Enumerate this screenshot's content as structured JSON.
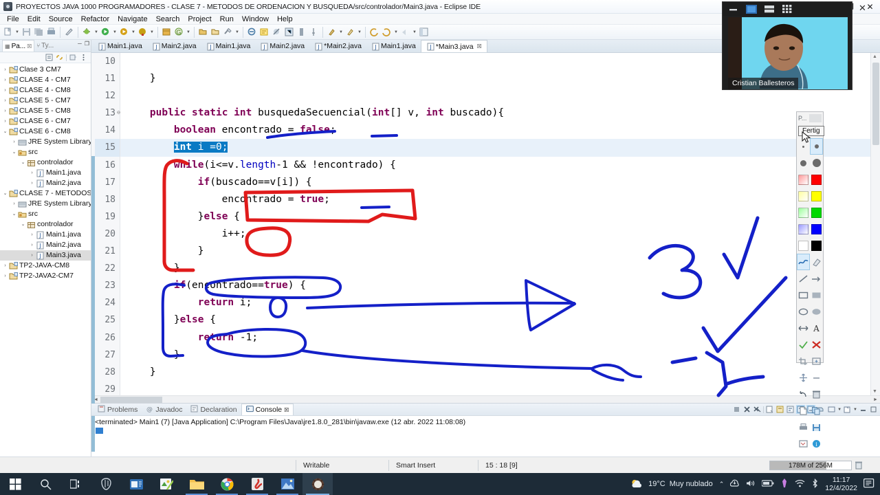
{
  "window": {
    "title": "PROYECTOS JAVA 1000 PROGRAMADORES - CLASE 7 - METODOS DE ORDENACION Y BUSQUEDA/src/controlador/Main3.java - Eclipse IDE",
    "icon": "eclipse-icon",
    "controls": {
      "minimize": "–",
      "maximize": "❐",
      "close": "✕"
    }
  },
  "menubar": {
    "items": [
      "File",
      "Edit",
      "Source",
      "Refactor",
      "Navigate",
      "Search",
      "Project",
      "Run",
      "Window",
      "Help"
    ]
  },
  "explorer": {
    "tabs": [
      {
        "label": "Pa...",
        "icon": "package-explorer-icon",
        "active": true,
        "close": "☒"
      },
      {
        "label": "Ty...",
        "icon": "type-hierarchy-icon",
        "active": false
      }
    ],
    "min_label": "─",
    "max_label": "❐",
    "toolbar_icons": [
      "collapse-all-icon",
      "link-with-editor-icon",
      "focus-icon",
      "view-menu-icon"
    ],
    "tree": [
      {
        "label": "Clase 3 CM7",
        "depth": 0,
        "icon": "java-project-icon",
        "twisty": "collapsed"
      },
      {
        "label": "CLASE 4 - CM7",
        "depth": 0,
        "icon": "java-project-icon",
        "twisty": "collapsed"
      },
      {
        "label": "CLASE 4 - CM8",
        "depth": 0,
        "icon": "java-project-icon",
        "twisty": "collapsed"
      },
      {
        "label": "CLASE 5 - CM7",
        "depth": 0,
        "icon": "java-project-icon",
        "twisty": "collapsed"
      },
      {
        "label": "CLASE 5 - CM8",
        "depth": 0,
        "icon": "java-project-icon",
        "twisty": "collapsed"
      },
      {
        "label": "CLASE 6 - CM7",
        "depth": 0,
        "icon": "java-project-icon",
        "twisty": "collapsed"
      },
      {
        "label": "CLASE 6 - CM8",
        "depth": 0,
        "icon": "java-project-icon",
        "twisty": "expanded"
      },
      {
        "label": "JRE System Library",
        "depth": 1,
        "icon": "jre-library-icon",
        "twisty": "collapsed"
      },
      {
        "label": "src",
        "depth": 1,
        "icon": "source-folder-icon",
        "twisty": "expanded"
      },
      {
        "label": "controlador",
        "depth": 2,
        "icon": "package-icon",
        "twisty": "expanded"
      },
      {
        "label": "Main1.java",
        "depth": 3,
        "icon": "java-file-icon",
        "twisty": "collapsed"
      },
      {
        "label": "Main2.java",
        "depth": 3,
        "icon": "java-file-icon",
        "twisty": "collapsed"
      },
      {
        "label": "CLASE 7 - METODOS",
        "depth": 0,
        "icon": "java-project-icon",
        "twisty": "expanded"
      },
      {
        "label": "JRE System Library",
        "depth": 1,
        "icon": "jre-library-icon",
        "twisty": "collapsed"
      },
      {
        "label": "src",
        "depth": 1,
        "icon": "source-folder-icon",
        "twisty": "expanded"
      },
      {
        "label": "controlador",
        "depth": 2,
        "icon": "package-icon",
        "twisty": "expanded"
      },
      {
        "label": "Main1.java",
        "depth": 3,
        "icon": "java-file-icon",
        "twisty": "collapsed"
      },
      {
        "label": "Main2.java",
        "depth": 3,
        "icon": "java-file-icon",
        "twisty": "collapsed"
      },
      {
        "label": "Main3.java",
        "depth": 3,
        "icon": "java-file-icon",
        "twisty": "collapsed",
        "selected": true
      },
      {
        "label": "TP2-JAVA-CM8",
        "depth": 0,
        "icon": "java-project-icon",
        "twisty": "collapsed"
      },
      {
        "label": "TP2-JAVA2-CM7",
        "depth": 0,
        "icon": "java-project-icon",
        "twisty": "collapsed"
      }
    ]
  },
  "editor": {
    "tabs": [
      {
        "label": "Main1.java",
        "active": false,
        "dirty": false
      },
      {
        "label": "Main2.java",
        "active": false,
        "dirty": false
      },
      {
        "label": "Main1.java",
        "active": false,
        "dirty": false
      },
      {
        "label": "Main2.java",
        "active": false,
        "dirty": false
      },
      {
        "label": "*Main2.java",
        "active": false,
        "dirty": true
      },
      {
        "label": "Main1.java",
        "active": false,
        "dirty": false
      },
      {
        "label": "*Main3.java",
        "active": true,
        "dirty": true,
        "close": "☒"
      }
    ],
    "first_line": 10,
    "highlighted_line": 15,
    "folding_line": 13,
    "lines": [
      {
        "n": 10,
        "text": ""
      },
      {
        "n": 11,
        "text": "    }"
      },
      {
        "n": 12,
        "text": ""
      },
      {
        "n": 13,
        "text": "    public static int busquedaSecuencial(int[] v, int buscado){"
      },
      {
        "n": 14,
        "text": "        boolean encontrado = false;"
      },
      {
        "n": 15,
        "text": "        int i =0;"
      },
      {
        "n": 16,
        "text": "        while(i<=v.length-1 && !encontrado) {"
      },
      {
        "n": 17,
        "text": "            if(buscado==v[i]) {"
      },
      {
        "n": 18,
        "text": "                encontrado = true;"
      },
      {
        "n": 19,
        "text": "            }else {"
      },
      {
        "n": 20,
        "text": "                i++;"
      },
      {
        "n": 21,
        "text": "            }"
      },
      {
        "n": 22,
        "text": "        }"
      },
      {
        "n": 23,
        "text": "        if(encontrado==true) {"
      },
      {
        "n": 24,
        "text": "            return i;"
      },
      {
        "n": 25,
        "text": "        }else {"
      },
      {
        "n": 26,
        "text": "            return -1;"
      },
      {
        "n": 27,
        "text": "        }"
      },
      {
        "n": 28,
        "text": "    }"
      },
      {
        "n": 29,
        "text": ""
      }
    ],
    "selection_text": "int i =0;"
  },
  "console": {
    "tabs": [
      {
        "label": "Problems",
        "icon": "problems-icon",
        "active": false
      },
      {
        "label": "Javadoc",
        "icon": "javadoc-icon",
        "active": false
      },
      {
        "label": "Declaration",
        "icon": "declaration-icon",
        "active": false
      },
      {
        "label": "Console",
        "icon": "console-icon",
        "active": true,
        "close": "☒"
      }
    ],
    "output": "<terminated> Main1 (7) [Java Application] C:\\Program Files\\Java\\jre1.8.0_281\\bin\\javaw.exe (12 abr. 2022 11:08:08)"
  },
  "statusbar": {
    "writable": "Writable",
    "insert_mode": "Smart Insert",
    "position": "15 : 18 [9]",
    "heap": "178M of 256M",
    "trash_icon": "trash-icon"
  },
  "palette": {
    "title": "P...",
    "tooltip": "Fertig",
    "colors": [
      [
        "#ff9a9a",
        "#ff0000"
      ],
      [
        "#ffffa0",
        "#ffff00"
      ],
      [
        "#9cff9c",
        "#00d900"
      ],
      [
        "#9b9bff",
        "#0000ff"
      ],
      [
        "#ffffff",
        "#000000"
      ]
    ],
    "tools": [
      [
        "pen-icon",
        "eraser-icon"
      ],
      [
        "line-icon",
        "arrow-icon"
      ],
      [
        "rectangle-icon",
        "filled-rectangle-icon"
      ],
      [
        "ellipse-icon",
        "filled-ellipse-icon"
      ],
      [
        "double-arrow-icon",
        "text-icon"
      ],
      [
        "check-icon",
        "cross-icon"
      ],
      [
        "crop-icon",
        "zoom-icon"
      ],
      [
        "move-icon",
        "minus-icon"
      ],
      [
        "undo-icon",
        "trash-icon"
      ],
      [
        "new-page-icon",
        "copy-icon"
      ],
      [
        "print-icon",
        "save-icon"
      ],
      [
        "screenshot-icon",
        "info-icon"
      ]
    ],
    "selected_size_index": 1
  },
  "webcam": {
    "name": "Cristian Ballesteros",
    "buttons": [
      "minimize-icon",
      "single-view-icon",
      "split-view-icon",
      "grid-view-icon"
    ],
    "close": "✕"
  },
  "taskbar": {
    "items": [
      {
        "icon": "windows-start-icon",
        "name": "start-button"
      },
      {
        "icon": "search-icon",
        "name": "taskbar-search"
      },
      {
        "icon": "task-view-icon",
        "name": "task-view"
      },
      {
        "icon": "postgresql-icon",
        "name": "taskbar-postgresql"
      },
      {
        "icon": "mail-icon",
        "name": "taskbar-mail"
      },
      {
        "icon": "notepad-icon",
        "name": "taskbar-editor"
      },
      {
        "icon": "file-explorer-icon",
        "name": "taskbar-file-explorer",
        "running": true
      },
      {
        "icon": "chrome-icon",
        "name": "taskbar-chrome",
        "running": true
      },
      {
        "icon": "pdf-icon",
        "name": "taskbar-pdf",
        "running": true
      },
      {
        "icon": "photos-icon",
        "name": "taskbar-photos",
        "running": true
      },
      {
        "icon": "eclipse-icon",
        "name": "taskbar-eclipse",
        "active": true
      }
    ],
    "tray": {
      "weather_icon": "partly-cloudy-icon",
      "temperature": "19°C",
      "condition": "Muy nublado",
      "chevron": "⌃",
      "icons": [
        "onedrive-icon",
        "volume-icon",
        "battery-icon",
        "pen-icon",
        "wifi-icon",
        "bluetooth-icon"
      ],
      "time": "11:17",
      "date": "12/4/2022",
      "notification_icon": "notification-icon"
    }
  },
  "annotations": {
    "red_color": "#e01b1b",
    "blue_color": "#1420c8",
    "shapes": [
      "red-bracket-while-loop",
      "red-box-encontrado-true",
      "red-circle-i-increment",
      "blue-underline-encontrado",
      "blue-underline-false",
      "blue-underline-true",
      "blue-oval-encontrado-true",
      "blue-oval-return-i",
      "blue-oval-return-minus1",
      "blue-bracket-if-else",
      "blue-arrow-to-right",
      "blue-arrow-long-right",
      "blue-digit-3",
      "blue-check-mark-1",
      "blue-check-mark-2",
      "blue-minus-one"
    ]
  }
}
